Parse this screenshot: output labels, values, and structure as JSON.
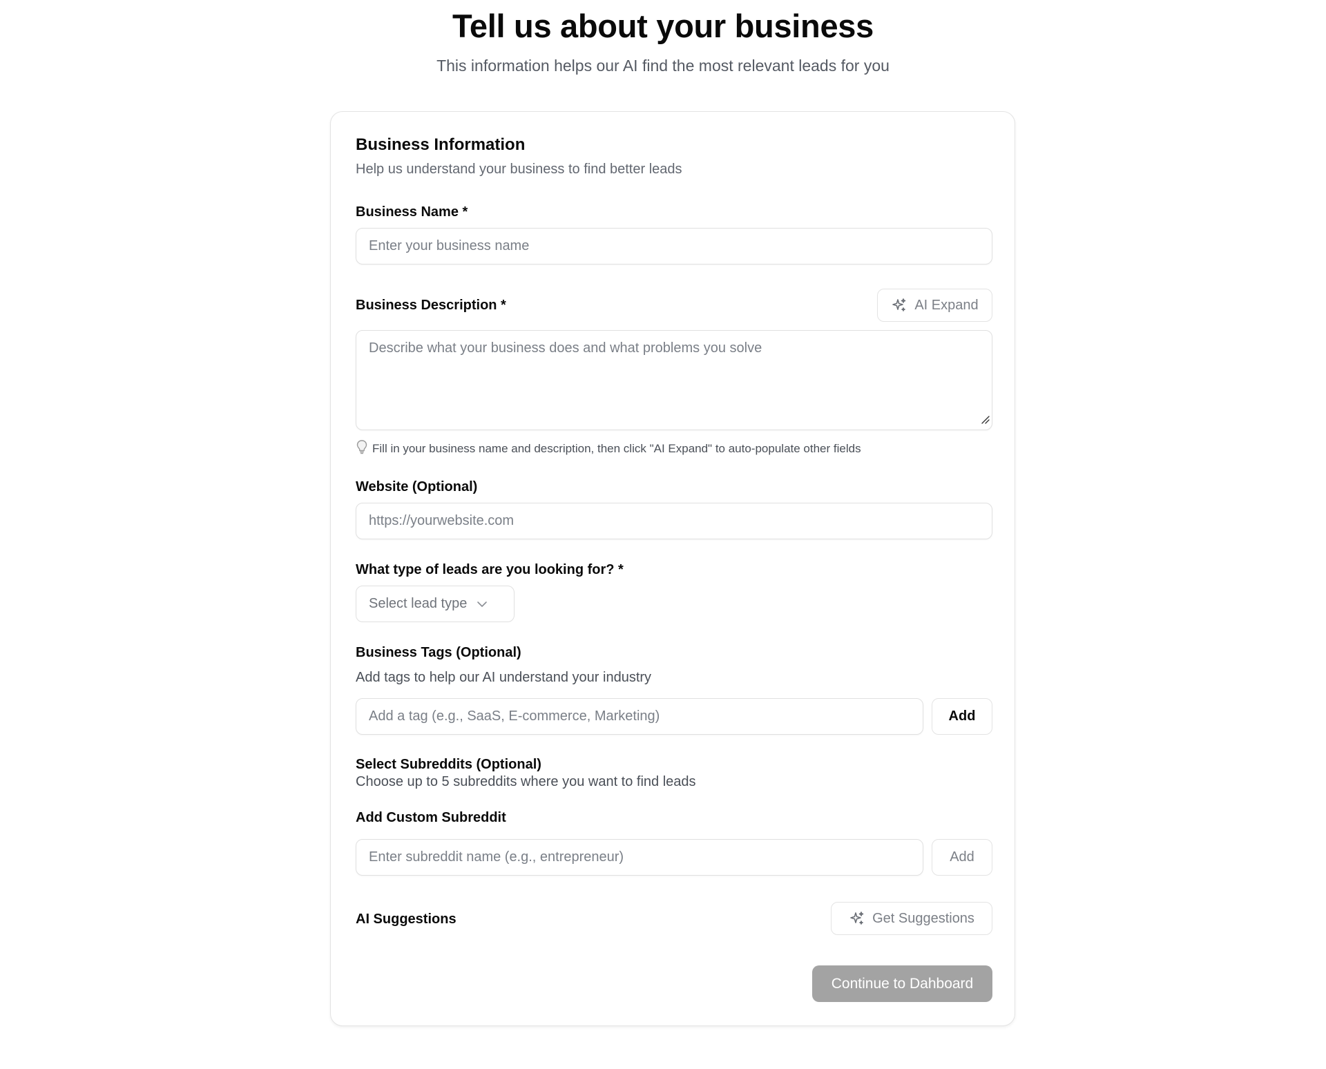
{
  "header": {
    "title": "Tell us about your business",
    "subtitle": "This information helps our AI find the most relevant leads for you"
  },
  "card": {
    "title": "Business Information",
    "subtitle": "Help us understand your business to find better leads"
  },
  "business_name": {
    "label": "Business Name *",
    "placeholder": "Enter your business name",
    "value": ""
  },
  "business_description": {
    "label": "Business Description *",
    "placeholder": "Describe what your business does and what problems you solve",
    "value": "",
    "ai_expand_label": "AI Expand",
    "hint_icon": "lightbulb-icon",
    "hint": "Fill in your business name and description, then click \"AI Expand\" to auto-populate other fields"
  },
  "website": {
    "label": "Website (Optional)",
    "placeholder": "https://yourwebsite.com",
    "value": ""
  },
  "lead_type": {
    "label": "What type of leads are you looking for? *",
    "selected": "Select lead type",
    "icon": "chevron-down-icon"
  },
  "tags": {
    "label": "Business Tags (Optional)",
    "description": "Add tags to help our AI understand your industry",
    "placeholder": "Add a tag (e.g., SaaS, E-commerce, Marketing)",
    "value": "",
    "add_label": "Add"
  },
  "subreddits": {
    "label": "Select Subreddits (Optional)",
    "description": "Choose up to 5 subreddits where you want to find leads",
    "custom_label": "Add Custom Subreddit",
    "placeholder": "Enter subreddit name (e.g., entrepreneur)",
    "value": "",
    "add_label": "Add"
  },
  "ai_suggestions": {
    "label": "AI Suggestions",
    "button_label": "Get Suggestions",
    "icon": "sparkles-icon"
  },
  "footer": {
    "continue_label": "Continue to Dahboard"
  },
  "colors": {
    "primary_disabled": "#a3a3a3",
    "border": "#e0e0e0",
    "muted_text": "#7b7f86"
  }
}
